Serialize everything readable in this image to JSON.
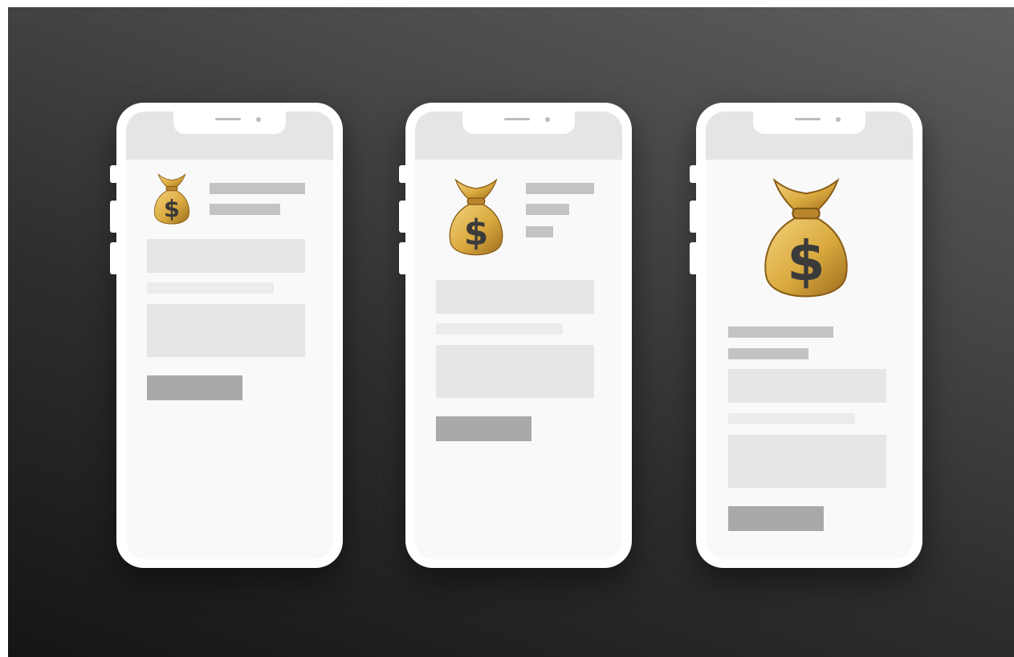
{
  "scene": {
    "background_colors": [
      "#5e5e5e",
      "#151515"
    ],
    "phone_color": "#ffffff",
    "screen_color": "#f9f9f9",
    "placeholder_colors": {
      "text_line": "#c3c3c3",
      "block": "#e6e6e6",
      "button": "#a9a9a9"
    }
  },
  "phones": [
    {
      "variant": "small-icon",
      "icon": "money-bag-icon",
      "icon_glyph": "$"
    },
    {
      "variant": "medium-icon",
      "icon": "money-bag-icon",
      "icon_glyph": "$"
    },
    {
      "variant": "large-icon",
      "icon": "money-bag-icon",
      "icon_glyph": "$"
    }
  ]
}
